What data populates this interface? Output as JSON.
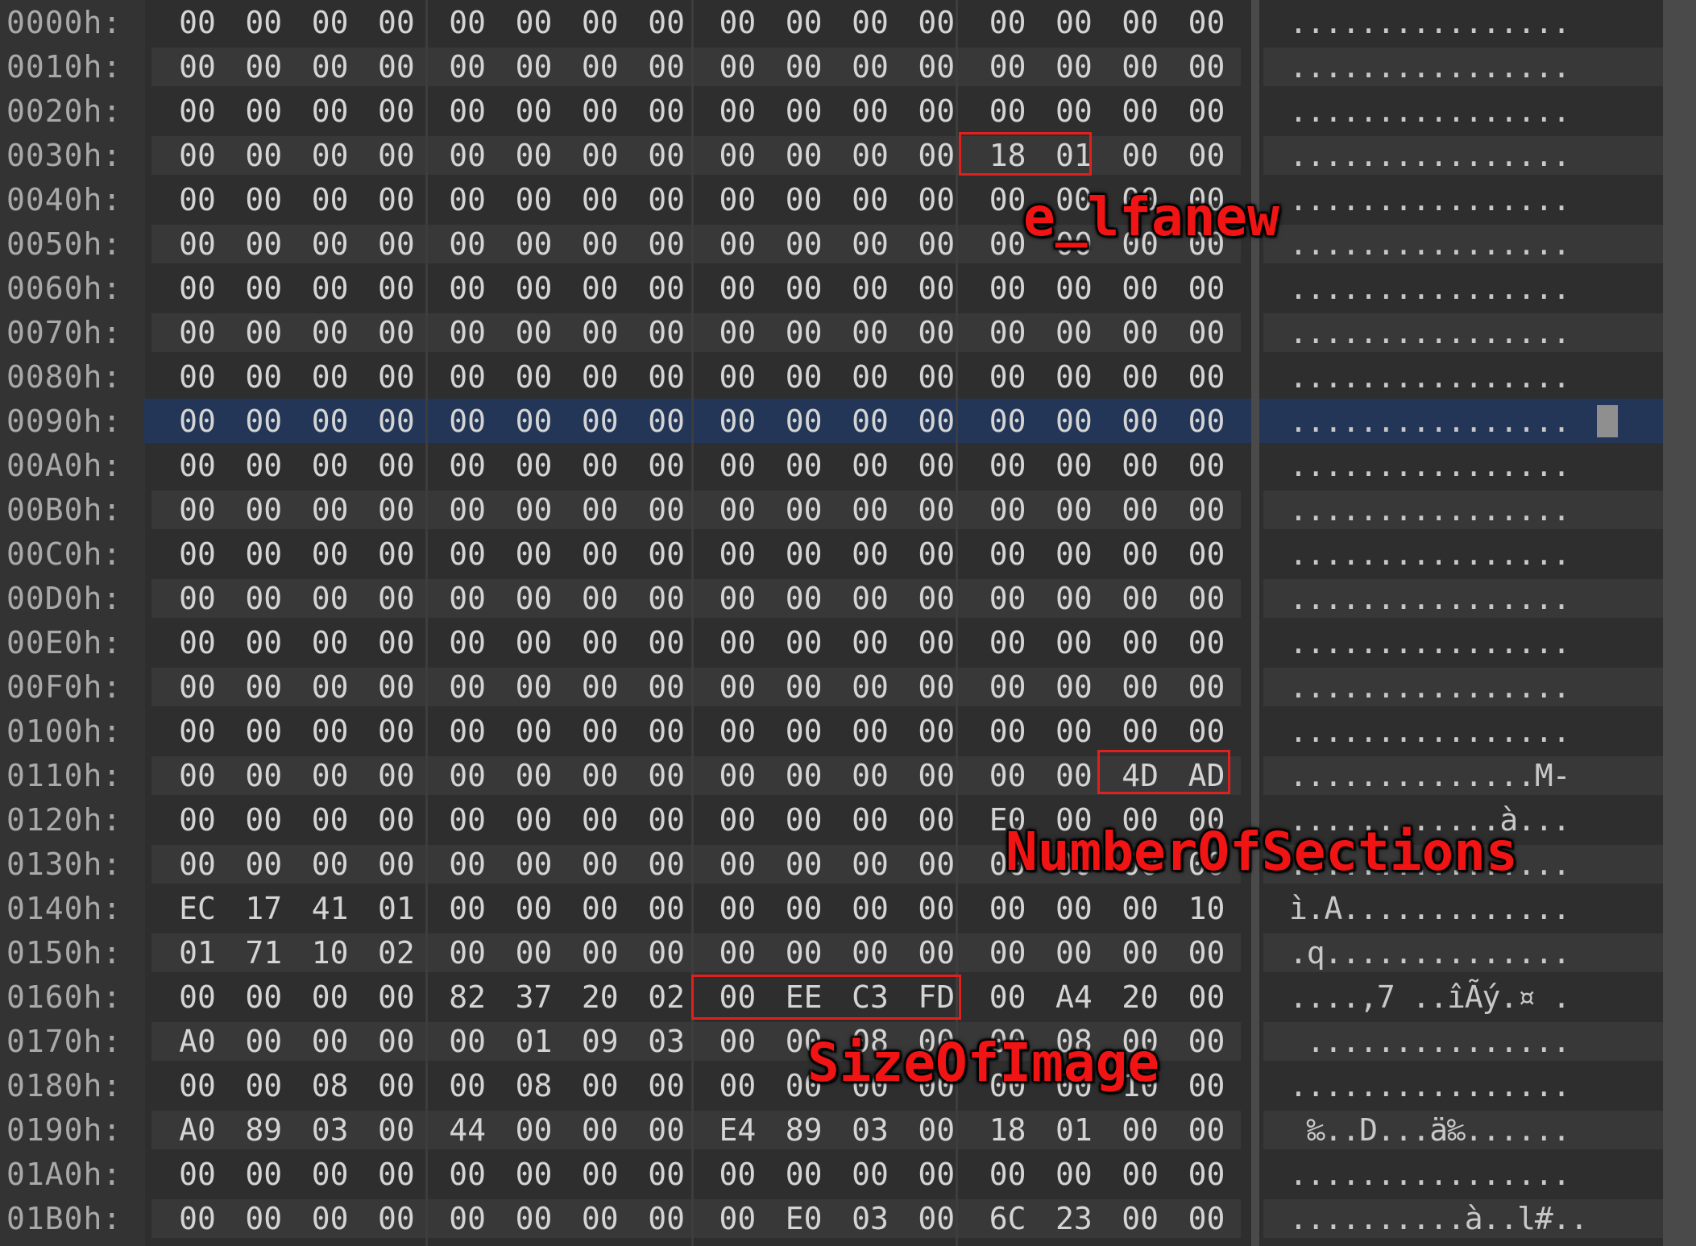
{
  "colors": {
    "background": "#2e2e2e",
    "text": "#d4d4d4",
    "address": "#a9a9a9",
    "selection": "#233657",
    "annotation": "#f01414"
  },
  "rows": [
    {
      "addr": "0000h:",
      "hex": [
        "00",
        "00",
        "00",
        "00",
        "00",
        "00",
        "00",
        "00",
        "00",
        "00",
        "00",
        "00",
        "00",
        "00",
        "00",
        "00"
      ],
      "ascii": "................"
    },
    {
      "addr": "0010h:",
      "hex": [
        "00",
        "00",
        "00",
        "00",
        "00",
        "00",
        "00",
        "00",
        "00",
        "00",
        "00",
        "00",
        "00",
        "00",
        "00",
        "00"
      ],
      "ascii": "................"
    },
    {
      "addr": "0020h:",
      "hex": [
        "00",
        "00",
        "00",
        "00",
        "00",
        "00",
        "00",
        "00",
        "00",
        "00",
        "00",
        "00",
        "00",
        "00",
        "00",
        "00"
      ],
      "ascii": "................"
    },
    {
      "addr": "0030h:",
      "hex": [
        "00",
        "00",
        "00",
        "00",
        "00",
        "00",
        "00",
        "00",
        "00",
        "00",
        "00",
        "00",
        "18",
        "01",
        "00",
        "00"
      ],
      "ascii": "................"
    },
    {
      "addr": "0040h:",
      "hex": [
        "00",
        "00",
        "00",
        "00",
        "00",
        "00",
        "00",
        "00",
        "00",
        "00",
        "00",
        "00",
        "00",
        "00",
        "00",
        "00"
      ],
      "ascii": "................"
    },
    {
      "addr": "0050h:",
      "hex": [
        "00",
        "00",
        "00",
        "00",
        "00",
        "00",
        "00",
        "00",
        "00",
        "00",
        "00",
        "00",
        "00",
        "00",
        "00",
        "00"
      ],
      "ascii": "................"
    },
    {
      "addr": "0060h:",
      "hex": [
        "00",
        "00",
        "00",
        "00",
        "00",
        "00",
        "00",
        "00",
        "00",
        "00",
        "00",
        "00",
        "00",
        "00",
        "00",
        "00"
      ],
      "ascii": "................"
    },
    {
      "addr": "0070h:",
      "hex": [
        "00",
        "00",
        "00",
        "00",
        "00",
        "00",
        "00",
        "00",
        "00",
        "00",
        "00",
        "00",
        "00",
        "00",
        "00",
        "00"
      ],
      "ascii": "................"
    },
    {
      "addr": "0080h:",
      "hex": [
        "00",
        "00",
        "00",
        "00",
        "00",
        "00",
        "00",
        "00",
        "00",
        "00",
        "00",
        "00",
        "00",
        "00",
        "00",
        "00"
      ],
      "ascii": "................"
    },
    {
      "addr": "0090h:",
      "hex": [
        "00",
        "00",
        "00",
        "00",
        "00",
        "00",
        "00",
        "00",
        "00",
        "00",
        "00",
        "00",
        "00",
        "00",
        "00",
        "00"
      ],
      "ascii": "................",
      "selected": true
    },
    {
      "addr": "00A0h:",
      "hex": [
        "00",
        "00",
        "00",
        "00",
        "00",
        "00",
        "00",
        "00",
        "00",
        "00",
        "00",
        "00",
        "00",
        "00",
        "00",
        "00"
      ],
      "ascii": "................"
    },
    {
      "addr": "00B0h:",
      "hex": [
        "00",
        "00",
        "00",
        "00",
        "00",
        "00",
        "00",
        "00",
        "00",
        "00",
        "00",
        "00",
        "00",
        "00",
        "00",
        "00"
      ],
      "ascii": "................"
    },
    {
      "addr": "00C0h:",
      "hex": [
        "00",
        "00",
        "00",
        "00",
        "00",
        "00",
        "00",
        "00",
        "00",
        "00",
        "00",
        "00",
        "00",
        "00",
        "00",
        "00"
      ],
      "ascii": "................"
    },
    {
      "addr": "00D0h:",
      "hex": [
        "00",
        "00",
        "00",
        "00",
        "00",
        "00",
        "00",
        "00",
        "00",
        "00",
        "00",
        "00",
        "00",
        "00",
        "00",
        "00"
      ],
      "ascii": "................"
    },
    {
      "addr": "00E0h:",
      "hex": [
        "00",
        "00",
        "00",
        "00",
        "00",
        "00",
        "00",
        "00",
        "00",
        "00",
        "00",
        "00",
        "00",
        "00",
        "00",
        "00"
      ],
      "ascii": "................"
    },
    {
      "addr": "00F0h:",
      "hex": [
        "00",
        "00",
        "00",
        "00",
        "00",
        "00",
        "00",
        "00",
        "00",
        "00",
        "00",
        "00",
        "00",
        "00",
        "00",
        "00"
      ],
      "ascii": "................"
    },
    {
      "addr": "0100h:",
      "hex": [
        "00",
        "00",
        "00",
        "00",
        "00",
        "00",
        "00",
        "00",
        "00",
        "00",
        "00",
        "00",
        "00",
        "00",
        "00",
        "00"
      ],
      "ascii": "................"
    },
    {
      "addr": "0110h:",
      "hex": [
        "00",
        "00",
        "00",
        "00",
        "00",
        "00",
        "00",
        "00",
        "00",
        "00",
        "00",
        "00",
        "00",
        "00",
        "4D",
        "AD"
      ],
      "ascii": "..............M-"
    },
    {
      "addr": "0120h:",
      "hex": [
        "00",
        "00",
        "00",
        "00",
        "00",
        "00",
        "00",
        "00",
        "00",
        "00",
        "00",
        "00",
        "E0",
        "00",
        "00",
        "00"
      ],
      "ascii": "............à..."
    },
    {
      "addr": "0130h:",
      "hex": [
        "00",
        "00",
        "00",
        "00",
        "00",
        "00",
        "00",
        "00",
        "00",
        "00",
        "00",
        "00",
        "00",
        "00",
        "00",
        "00"
      ],
      "ascii": "................"
    },
    {
      "addr": "0140h:",
      "hex": [
        "EC",
        "17",
        "41",
        "01",
        "00",
        "00",
        "00",
        "00",
        "00",
        "00",
        "00",
        "00",
        "00",
        "00",
        "00",
        "10"
      ],
      "ascii": "ì.A............."
    },
    {
      "addr": "0150h:",
      "hex": [
        "01",
        "71",
        "10",
        "02",
        "00",
        "00",
        "00",
        "00",
        "00",
        "00",
        "00",
        "00",
        "00",
        "00",
        "00",
        "00"
      ],
      "ascii": ".q.............."
    },
    {
      "addr": "0160h:",
      "hex": [
        "00",
        "00",
        "00",
        "00",
        "82",
        "37",
        "20",
        "02",
        "00",
        "EE",
        "C3",
        "FD",
        "00",
        "A4",
        "20",
        "00"
      ],
      "ascii": "....,7 ..îÃý.¤ ."
    },
    {
      "addr": "0170h:",
      "hex": [
        "A0",
        "00",
        "00",
        "00",
        "00",
        "01",
        "09",
        "03",
        "00",
        "00",
        "08",
        "00",
        "00",
        "08",
        "00",
        "00"
      ],
      "ascii": " ..............."
    },
    {
      "addr": "0180h:",
      "hex": [
        "00",
        "00",
        "08",
        "00",
        "00",
        "08",
        "00",
        "00",
        "00",
        "00",
        "00",
        "00",
        "00",
        "00",
        "10",
        "00"
      ],
      "ascii": "................"
    },
    {
      "addr": "0190h:",
      "hex": [
        "A0",
        "89",
        "03",
        "00",
        "44",
        "00",
        "00",
        "00",
        "E4",
        "89",
        "03",
        "00",
        "18",
        "01",
        "00",
        "00"
      ],
      "ascii": " ‰..D...ä‰......"
    },
    {
      "addr": "01A0h:",
      "hex": [
        "00",
        "00",
        "00",
        "00",
        "00",
        "00",
        "00",
        "00",
        "00",
        "00",
        "00",
        "00",
        "00",
        "00",
        "00",
        "00"
      ],
      "ascii": "................"
    },
    {
      "addr": "01B0h:",
      "hex": [
        "00",
        "00",
        "00",
        "00",
        "00",
        "00",
        "00",
        "00",
        "00",
        "E0",
        "03",
        "00",
        "6C",
        "23",
        "00",
        "00"
      ],
      "ascii": "..........à..l#.."
    }
  ],
  "annotations": {
    "e_lfanew": "e_lfanew",
    "number_of_sections": "NumberOfSections",
    "size_of_image": "SizeOfImage"
  }
}
